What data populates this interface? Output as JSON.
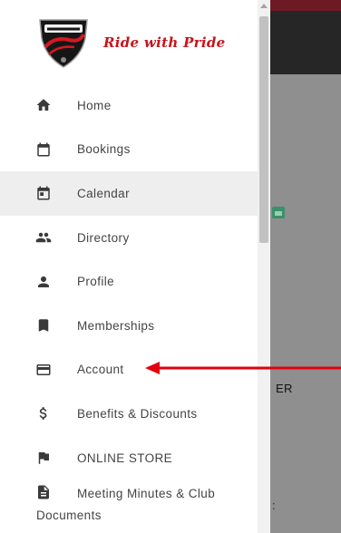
{
  "header": {
    "logo_icon": "triumph-riders-logo-icon",
    "slogan": "Ride with Pride"
  },
  "nav": {
    "items": [
      {
        "label": "Home",
        "icon": "home-icon",
        "active": false
      },
      {
        "label": "Bookings",
        "icon": "calendar-outline-icon",
        "active": false
      },
      {
        "label": "Calendar",
        "icon": "calendar-event-icon",
        "active": true
      },
      {
        "label": "Directory",
        "icon": "people-icon",
        "active": false
      },
      {
        "label": "Profile",
        "icon": "person-icon",
        "active": false
      },
      {
        "label": "Memberships",
        "icon": "bookmark-icon",
        "active": false
      },
      {
        "label": "Account",
        "icon": "credit-card-icon",
        "active": false
      },
      {
        "label": "Benefits & Discounts",
        "icon": "dollar-icon",
        "active": false
      },
      {
        "label": "ONLINE STORE",
        "icon": "flag-icon",
        "active": false
      },
      {
        "label": "Meeting Minutes & Club Documents",
        "icon": "document-icon",
        "active": false
      }
    ]
  },
  "background": {
    "partial_text": "ER",
    "partial_punct": ":"
  },
  "colors": {
    "brand_red": "#c5151c",
    "annotation_arrow": "#e3000f",
    "active_item_bg": "#eeeeee"
  }
}
